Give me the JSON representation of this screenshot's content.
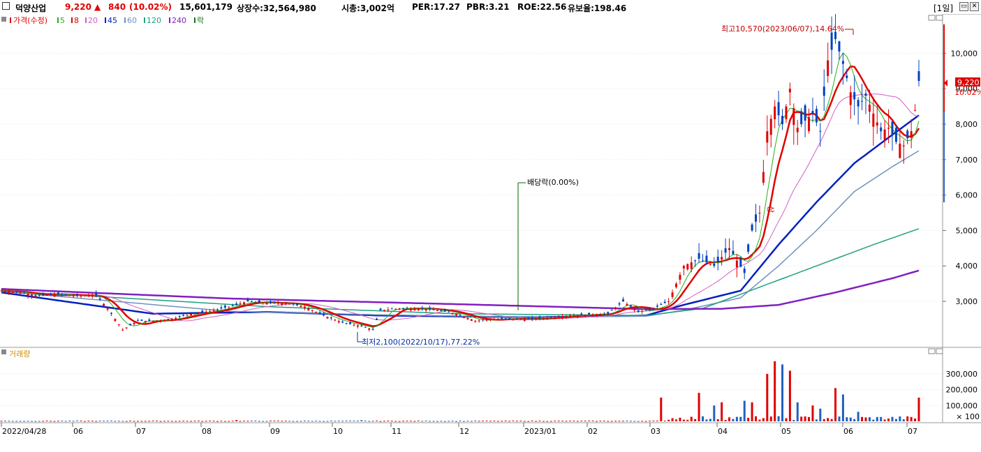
{
  "header": {
    "stock_name": "덕양산업",
    "price": "9,220",
    "change_arrow": "▲",
    "change": "840",
    "change_pct": "(10.02%)",
    "volume": "15,601,179",
    "listed_shares": "상장수:32,564,980",
    "market_cap": "시총:3,002억",
    "per": "PER:17.27",
    "pbr": "PBR:3.21",
    "roe": "ROE:22.56",
    "retention": "유보율:198.46",
    "period": "[1일]",
    "colors": {
      "up": "#e00000",
      "down": "#0040c0"
    }
  },
  "legend": {
    "price_label": "가격(수정)",
    "ma": [
      {
        "label": "5",
        "color": "#22b022"
      },
      {
        "label": "8",
        "color": "#e00000"
      },
      {
        "label": "20",
        "color": "#d060c0"
      },
      {
        "label": "45",
        "color": "#0020c0"
      },
      {
        "label": "60",
        "color": "#7090c0"
      },
      {
        "label": "120",
        "color": "#20a080"
      },
      {
        "label": "240",
        "color": "#8020c0"
      }
    ],
    "ex_label": "락",
    "volume_label": "거래량"
  },
  "annotations": {
    "high": "최고10,570(2023/06/07),14.64%",
    "low": "최저2,100(2022/10/17),77.22%",
    "dividend": "배당락(0.00%)",
    "marker": "상"
  },
  "price_tag": {
    "value": "9,220",
    "pct": "10.02%"
  },
  "chart_data": {
    "type": "candlestick",
    "price_axis": {
      "ticks": [
        3000,
        4000,
        5000,
        6000,
        7000,
        8000,
        9000,
        10000
      ],
      "tick_labels": [
        "3,000",
        "4,000",
        "5,000",
        "6,000",
        "7,000",
        "8,000",
        "9,000",
        "10,000"
      ],
      "range": [
        2000,
        11000
      ]
    },
    "volume_axis": {
      "ticks": [
        100000,
        200000,
        300000
      ],
      "tick_labels": [
        "100,000",
        "200,000",
        "300,000"
      ],
      "unit_label": "× 100",
      "range": [
        0,
        420000
      ]
    },
    "x_labels": [
      "2022/04/28",
      "06",
      "07",
      "08",
      "09",
      "10",
      "11",
      "12",
      "2023/01",
      "02",
      "03",
      "04",
      "05",
      "06",
      "07"
    ],
    "price_path": [
      [
        0,
        3300
      ],
      [
        5,
        3250
      ],
      [
        10,
        3150
      ],
      [
        15,
        3200
      ],
      [
        20,
        3150
      ],
      [
        25,
        3180
      ],
      [
        28,
        2800
      ],
      [
        32,
        2200
      ],
      [
        36,
        2450
      ],
      [
        40,
        2450
      ],
      [
        45,
        2500
      ],
      [
        50,
        2650
      ],
      [
        55,
        2720
      ],
      [
        60,
        2850
      ],
      [
        65,
        3000
      ],
      [
        70,
        2950
      ],
      [
        75,
        2950
      ],
      [
        80,
        2850
      ],
      [
        85,
        2600
      ],
      [
        90,
        2400
      ],
      [
        95,
        2300
      ],
      [
        98,
        2200
      ],
      [
        100,
        2750
      ],
      [
        105,
        2800
      ],
      [
        110,
        2800
      ],
      [
        115,
        2750
      ],
      [
        120,
        2650
      ],
      [
        125,
        2450
      ],
      [
        130,
        2500
      ],
      [
        135,
        2500
      ],
      [
        140,
        2500
      ],
      [
        150,
        2600
      ],
      [
        160,
        2650
      ],
      [
        164,
        3000
      ],
      [
        168,
        2700
      ],
      [
        172,
        2800
      ],
      [
        176,
        3000
      ],
      [
        180,
        4000
      ],
      [
        184,
        4200
      ],
      [
        188,
        4000
      ],
      [
        192,
        4500
      ],
      [
        196,
        3800
      ],
      [
        198,
        5000
      ],
      [
        200,
        5500
      ],
      [
        202,
        7800
      ],
      [
        204,
        8500
      ],
      [
        206,
        8000
      ],
      [
        208,
        9000
      ],
      [
        210,
        7900
      ],
      [
        212,
        8100
      ],
      [
        214,
        8300
      ],
      [
        216,
        7800
      ],
      [
        218,
        9800
      ],
      [
        220,
        10400
      ],
      [
        222,
        9700
      ],
      [
        224,
        8900
      ],
      [
        226,
        8500
      ],
      [
        228,
        8800
      ],
      [
        230,
        8300
      ],
      [
        232,
        7800
      ],
      [
        234,
        7900
      ],
      [
        236,
        7500
      ],
      [
        238,
        7400
      ],
      [
        240,
        7800
      ],
      [
        241,
        8400
      ],
      [
        242,
        9220
      ]
    ],
    "ma_series": [
      {
        "name": "45",
        "values": [
          [
            0,
            3250
          ],
          [
            40,
            2650
          ],
          [
            70,
            2700
          ],
          [
            100,
            2600
          ],
          [
            140,
            2550
          ],
          [
            170,
            2600
          ],
          [
            180,
            2900
          ],
          [
            195,
            3300
          ],
          [
            205,
            4600
          ],
          [
            215,
            5800
          ],
          [
            225,
            6900
          ],
          [
            235,
            7700
          ],
          [
            242,
            8250
          ]
        ]
      },
      {
        "name": "60",
        "values": [
          [
            0,
            3280
          ],
          [
            60,
            2720
          ],
          [
            100,
            2620
          ],
          [
            140,
            2550
          ],
          [
            170,
            2580
          ],
          [
            180,
            2750
          ],
          [
            195,
            3100
          ],
          [
            205,
            4000
          ],
          [
            215,
            5000
          ],
          [
            225,
            6100
          ],
          [
            235,
            6800
          ],
          [
            242,
            7250
          ]
        ]
      },
      {
        "name": "120",
        "values": [
          [
            0,
            3300
          ],
          [
            70,
            2850
          ],
          [
            120,
            2650
          ],
          [
            170,
            2600
          ],
          [
            185,
            2800
          ],
          [
            200,
            3400
          ],
          [
            215,
            4000
          ],
          [
            230,
            4600
          ],
          [
            242,
            5050
          ]
        ]
      },
      {
        "name": "240",
        "values": [
          [
            0,
            3350
          ],
          [
            60,
            3080
          ],
          [
            120,
            2920
          ],
          [
            170,
            2780
          ],
          [
            190,
            2790
          ],
          [
            205,
            2900
          ],
          [
            220,
            3250
          ],
          [
            235,
            3650
          ],
          [
            242,
            3870
          ]
        ]
      }
    ],
    "volume_spikes": [
      [
        62,
        8000
      ],
      [
        95,
        7000
      ],
      [
        174,
        150000
      ],
      [
        184,
        180000
      ],
      [
        188,
        100000
      ],
      [
        190,
        120000
      ],
      [
        196,
        130000
      ],
      [
        198,
        120000
      ],
      [
        202,
        300000
      ],
      [
        204,
        380000
      ],
      [
        206,
        360000
      ],
      [
        208,
        320000
      ],
      [
        210,
        120000
      ],
      [
        214,
        100000
      ],
      [
        216,
        80000
      ],
      [
        220,
        210000
      ],
      [
        222,
        170000
      ],
      [
        226,
        60000
      ],
      [
        242,
        150000
      ]
    ]
  }
}
